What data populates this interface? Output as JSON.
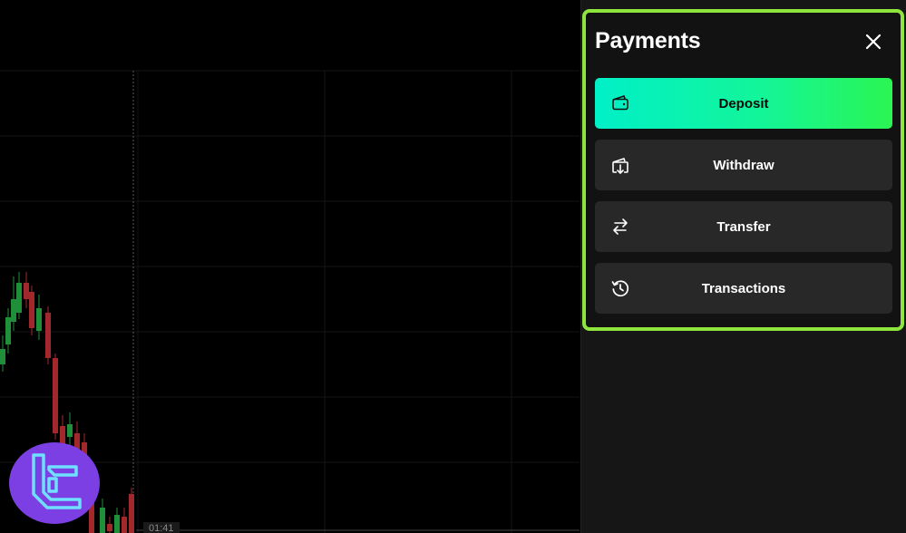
{
  "chart": {
    "time_label": "01:41",
    "colors": {
      "up": "#1f8f3a",
      "down": "#a3282c",
      "grid": "#141414"
    }
  },
  "panel": {
    "title": "Payments",
    "accent_color": "#8ee63c",
    "close_icon": "close-icon",
    "buttons": [
      {
        "id": "deposit",
        "label": "Deposit",
        "icon": "wallet-icon"
      },
      {
        "id": "withdraw",
        "label": "Withdraw",
        "icon": "withdraw-icon"
      },
      {
        "id": "transfer",
        "label": "Transfer",
        "icon": "transfer-arrows-icon"
      },
      {
        "id": "transactions",
        "label": "Transactions",
        "icon": "history-icon"
      }
    ]
  }
}
